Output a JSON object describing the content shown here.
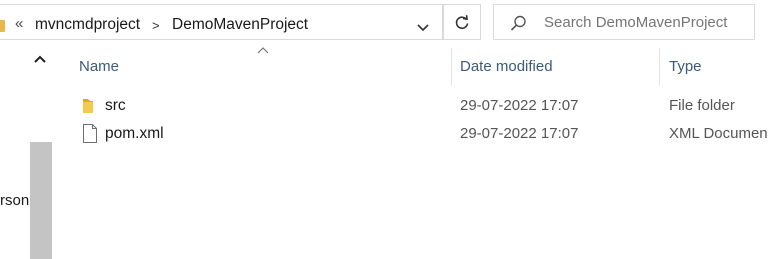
{
  "address_bar": {
    "overflow": "«",
    "breadcrumbs": [
      "mvncmdproject",
      "DemoMavenProject"
    ],
    "separator": ">"
  },
  "search": {
    "placeholder": "Search DemoMavenProject"
  },
  "nav_pane": {
    "visible_text": "rson"
  },
  "columns": {
    "name": "Name",
    "date_modified": "Date modified",
    "type": "Type"
  },
  "files": [
    {
      "name": "src",
      "date_modified": "29-07-2022 17:07",
      "type": "File folder",
      "icon": "folder-icon"
    },
    {
      "name": "pom.xml",
      "date_modified": "29-07-2022 17:07",
      "type": "XML Documen",
      "icon": "file-icon"
    }
  ],
  "colors": {
    "folder": "#e8b84a",
    "header_text": "#3b5a7c",
    "scrollbar": "#c4c4c4"
  }
}
